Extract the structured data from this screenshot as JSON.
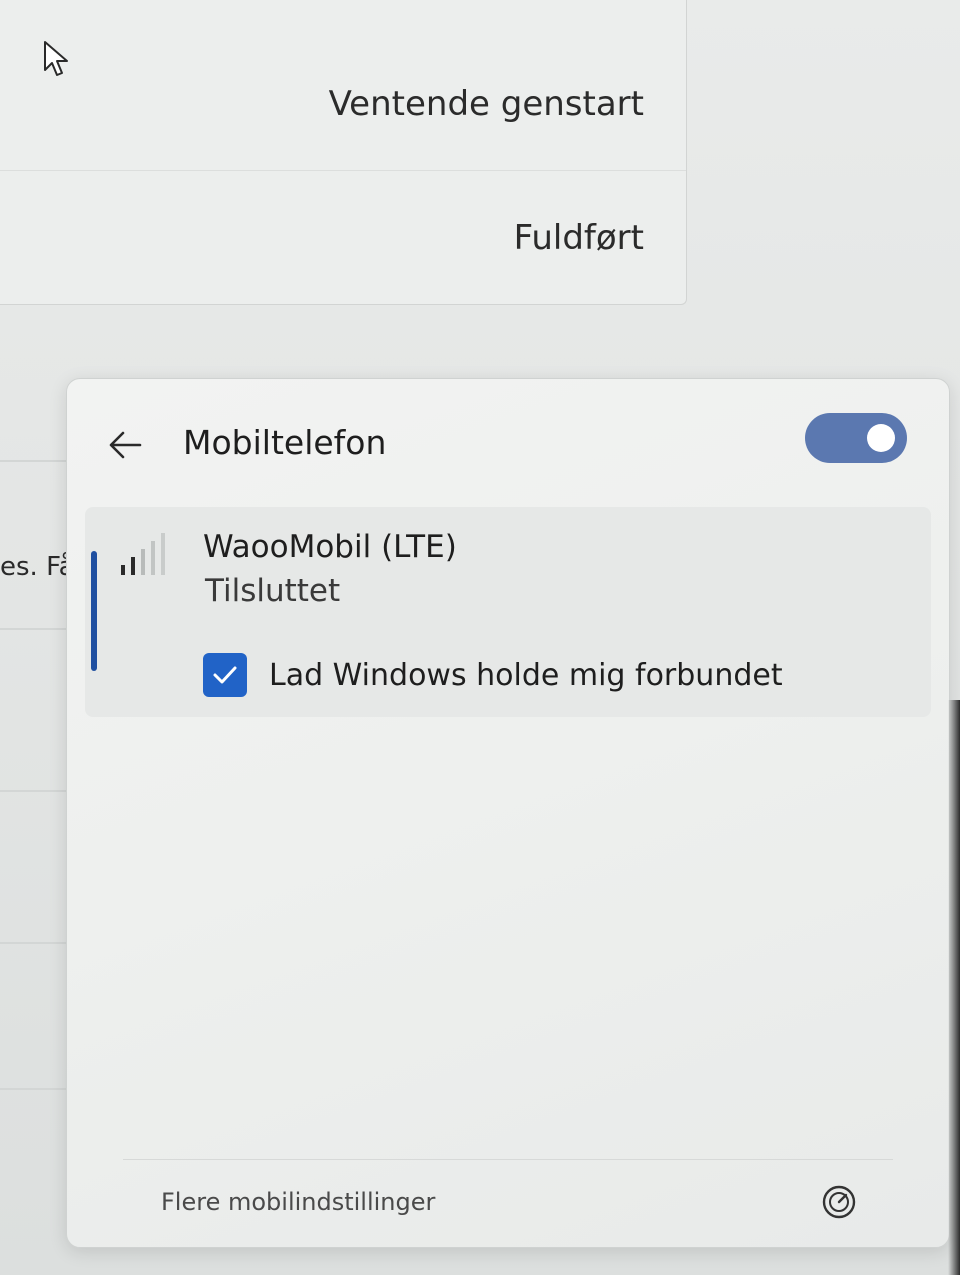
{
  "background": {
    "rows": [
      {
        "label": "Ventende genstart"
      },
      {
        "label": "Fuldført"
      }
    ],
    "left_partial_text": "es. Få"
  },
  "flyout": {
    "title": "Mobiltelefon",
    "toggle": {
      "on": true
    },
    "network": {
      "name": "WaooMobil (LTE)",
      "status": "Tilsluttet",
      "signal_icon": "cellular-signal-icon",
      "auto_connect_label": "Lad Windows holde mig forbundet",
      "auto_connect_checked": true
    },
    "footer": {
      "link_label": "Flere mobilindstillinger",
      "icon": "settings-gauge-icon"
    }
  },
  "colors": {
    "accent": "#2163c7",
    "toggle": "#5b78b0",
    "indicator": "#1f4fa0"
  }
}
